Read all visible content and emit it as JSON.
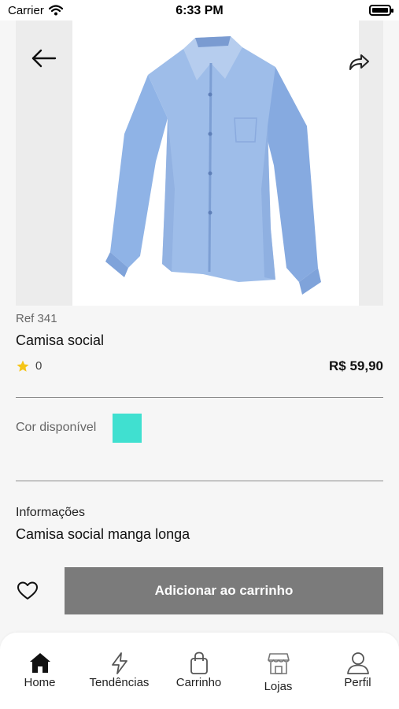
{
  "status_bar": {
    "carrier": "Carrier",
    "time": "6:33 PM"
  },
  "product": {
    "ref": "Ref 341",
    "title": "Camisa social",
    "rating": "0",
    "price": "R$ 59,90",
    "image_icon": "dress-shirt-image"
  },
  "colors": {
    "label": "Cor disponível",
    "swatch": "#40E0D0"
  },
  "info": {
    "heading": "Informações",
    "text": "Camisa social manga longa"
  },
  "actions": {
    "add_to_cart": "Adicionar ao carrinho",
    "button_color": "#7b7b7b"
  },
  "tabbar": {
    "items": [
      {
        "label": "Home",
        "icon": "home-icon"
      },
      {
        "label": "Tendências",
        "icon": "lightning-icon"
      },
      {
        "label": "Carrinho",
        "icon": "shopping-bag-icon"
      },
      {
        "label": "Lojas",
        "icon": "store-icon"
      },
      {
        "label": "Perfil",
        "icon": "user-icon"
      }
    ]
  }
}
